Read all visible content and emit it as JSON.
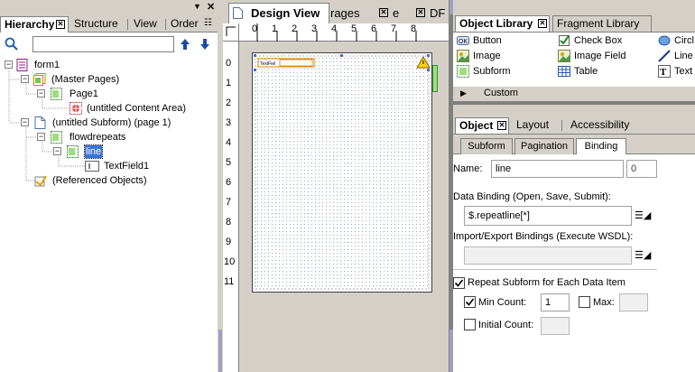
{
  "hierarchy": {
    "tabs": [
      "Hierarchy",
      "Structure",
      "View",
      "Order"
    ],
    "search_value": "",
    "tree": [
      {
        "label": "form1"
      },
      {
        "label": "(Master Pages)"
      },
      {
        "label": "Page1"
      },
      {
        "label": "(untitled Content Area)"
      },
      {
        "label": "(untitled Subform) (page 1)"
      },
      {
        "label": "flowdrepeats"
      },
      {
        "label": "line"
      },
      {
        "label": "TextField1"
      },
      {
        "label": "(Referenced Objects)"
      }
    ]
  },
  "design": {
    "tabs": [
      "Design View",
      "rages",
      "e",
      "DF"
    ],
    "ruler_top": [
      "0",
      "1",
      "2",
      "3",
      "4",
      "5",
      "6",
      "7",
      "8"
    ],
    "ruler_left": [
      "0",
      "1",
      "2",
      "3",
      "4",
      "5",
      "6",
      "7",
      "8",
      "9",
      "10",
      "11"
    ]
  },
  "library": {
    "tabs": [
      "Object Library",
      "Fragment Library"
    ],
    "items": [
      {
        "label": "Button",
        "icon": "button-icon"
      },
      {
        "label": "Check Box",
        "icon": "checkbox-icon"
      },
      {
        "label": "Circl",
        "icon": "circle-icon"
      },
      {
        "label": "Image",
        "icon": "image-icon"
      },
      {
        "label": "Image Field",
        "icon": "image-field-icon"
      },
      {
        "label": "Line",
        "icon": "line-icon"
      },
      {
        "label": "Subform",
        "icon": "subform-icon"
      },
      {
        "label": "Table",
        "icon": "table-icon"
      },
      {
        "label": "Text",
        "icon": "text-icon"
      }
    ],
    "category": "Custom"
  },
  "object": {
    "tabs": [
      "Object",
      "Layout",
      "Accessibility"
    ],
    "subtabs": [
      "Subform",
      "Pagination",
      "Binding"
    ],
    "name_label": "Name:",
    "name_value": "line",
    "name_index": "0",
    "data_binding_label": "Data Binding (Open, Save, Submit):",
    "data_binding_value": "$.repeatline[*]",
    "import_export_label": "Import/Export Bindings (Execute WSDL):",
    "import_export_value": "",
    "repeat_label": "Repeat Subform for Each Data Item",
    "repeat_checked": true,
    "min_count_label": "Min Count:",
    "min_count_checked": true,
    "min_count_value": "1",
    "max_label": "Max:",
    "max_checked": false,
    "max_value": "",
    "initial_count_label": "Initial Count:",
    "initial_count_checked": false,
    "initial_count_value": ""
  }
}
